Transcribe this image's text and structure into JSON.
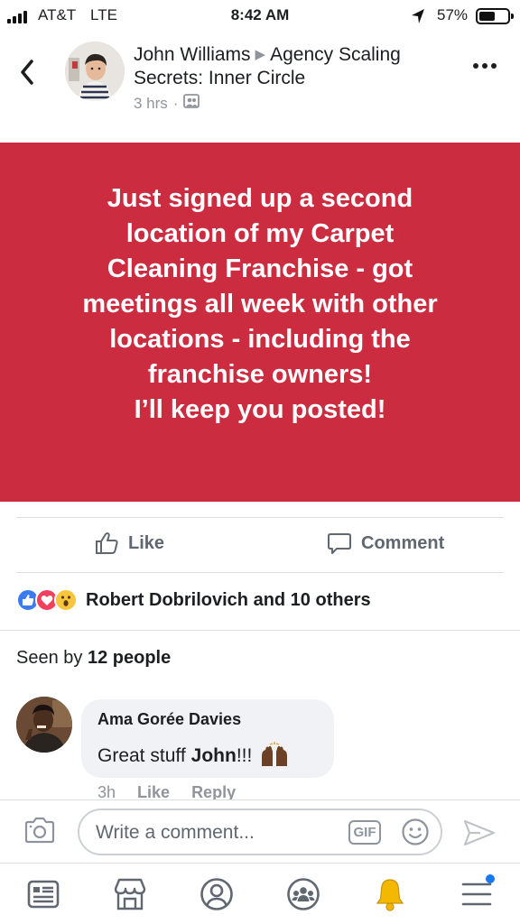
{
  "status_bar": {
    "carrier": "AT&T",
    "network": "LTE",
    "time": "8:42 AM",
    "battery_percent_label": "57%",
    "battery_level": 0.57,
    "signal_icon": "signal-bars-icon",
    "location_icon": "location-arrow-icon"
  },
  "post": {
    "author": "John Williams",
    "group": "Agency Scaling Secrets: Inner Circle",
    "time_ago": "3 hrs",
    "separator": "·",
    "audience_icon": "group-audience-icon",
    "banner_text": "Just signed up a second\nlocation of my Carpet\nCleaning Franchise - got\nmeetings all week with other\nlocations - including the\nfranchise owners!\nI’ll keep you posted!",
    "banner_color": "#cc2c40"
  },
  "actions": {
    "like_label": "Like",
    "comment_label": "Comment"
  },
  "reactions": {
    "types": [
      "like",
      "love",
      "wow"
    ],
    "summary": "Robert Dobrilovich and 10 others"
  },
  "seen": {
    "prefix": "Seen by",
    "count_text": "12 people"
  },
  "comment": {
    "author": "Ama Gorée Davies",
    "text_prefix": "Great stuff",
    "text_bold": "John",
    "text_suffix": "!!!",
    "emoji": "raising-hands-icon",
    "time": "3h",
    "like_label": "Like",
    "reply_label": "Reply"
  },
  "composer": {
    "placeholder": "Write a comment...",
    "gif_label": "GIF"
  },
  "tab_bar": {
    "items": [
      "news-feed-icon",
      "marketplace-icon",
      "profile-icon",
      "groups-icon",
      "notifications-bell-icon",
      "menu-icon"
    ],
    "accent": "#1877f2"
  }
}
